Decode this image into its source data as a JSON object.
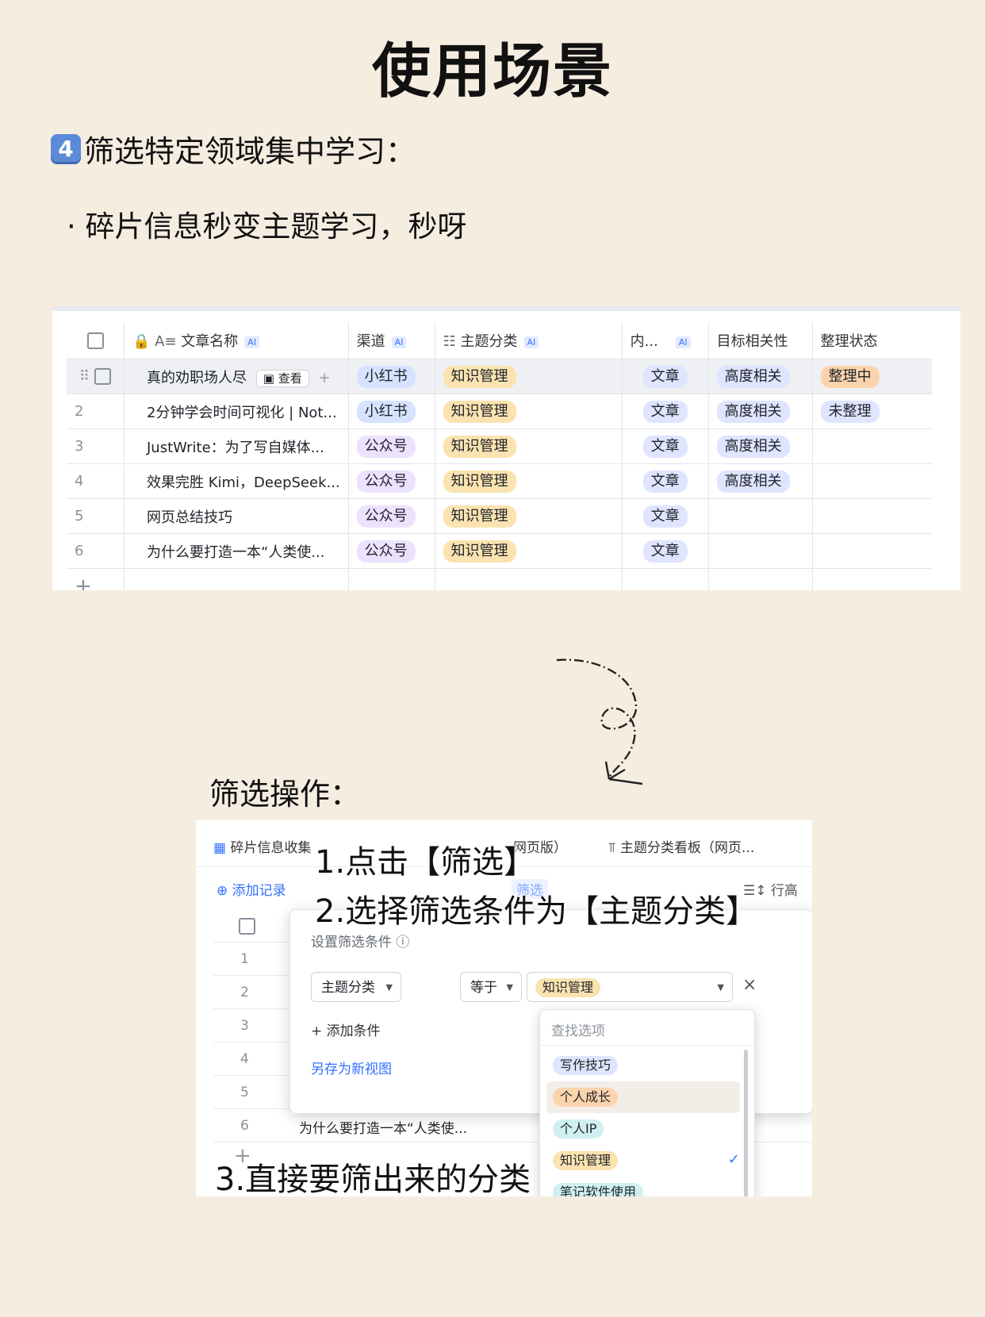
{
  "title": "使用场景",
  "section": {
    "keycap": "4",
    "heading": "筛选特定领域集中学习："
  },
  "bullet": "· 碎片信息秒变主题学习，秒呀",
  "table1": {
    "columns": [
      {
        "label": "文章名称",
        "ai": "AI"
      },
      {
        "label": "渠道",
        "ai": "AI"
      },
      {
        "label": "主题分类",
        "ai": "AI"
      },
      {
        "label": "内...",
        "ai": "AI"
      },
      {
        "label": "目标相关性",
        "ai": ""
      },
      {
        "label": "整理状态",
        "ai": ""
      }
    ],
    "view_label": "查看",
    "rows": [
      {
        "num": "",
        "name": "真的劝职场人尽",
        "channel": "小红书",
        "topic": "知识管理",
        "type": "文章",
        "relevance": "高度相关",
        "status": "整理中"
      },
      {
        "num": "2",
        "name": "2分钟学会时间可视化 | Not...",
        "channel": "小红书",
        "topic": "知识管理",
        "type": "文章",
        "relevance": "高度相关",
        "status": "未整理"
      },
      {
        "num": "3",
        "name": "JustWrite：为了写自媒体...",
        "channel": "公众号",
        "topic": "知识管理",
        "type": "文章",
        "relevance": "高度相关",
        "status": ""
      },
      {
        "num": "4",
        "name": "效果完胜 Kimi，DeepSeek...",
        "channel": "公众号",
        "topic": "知识管理",
        "type": "文章",
        "relevance": "高度相关",
        "status": ""
      },
      {
        "num": "5",
        "name": "网页总结技巧",
        "channel": "公众号",
        "topic": "知识管理",
        "type": "文章",
        "relevance": "",
        "status": ""
      },
      {
        "num": "6",
        "name": "为什么要打造一本“人类使...",
        "channel": "公众号",
        "topic": "知识管理",
        "type": "文章",
        "relevance": "",
        "status": ""
      }
    ],
    "add_row": "+"
  },
  "filter_title": "筛选操作：",
  "screen2": {
    "tab1": "碎片信息收集",
    "tab1_suffix": "网页版）",
    "tab2": "主题分类看板（网页...",
    "add_record": "添加记录",
    "filter_btn": "筛选",
    "row_height": "行高",
    "rows": [
      "1",
      "2",
      "3",
      "4",
      "5",
      "6"
    ],
    "row6_text": "为什么要打造一本“人类使...",
    "panel": {
      "heading": "设置筛选条件",
      "field": "主题分类",
      "operator": "等于",
      "value": "知识管理",
      "add_condition": "+ 添加条件",
      "save_view": "另存为新视图"
    },
    "dropdown": {
      "placeholder": "查找选项",
      "options": [
        "写作技巧",
        "个人成长",
        "个人IP",
        "知识管理",
        "笔记软件使用"
      ]
    },
    "add_row": "+"
  },
  "steps": {
    "step1": "1.点击【筛选】",
    "step2": "2.选择筛选条件为【主题分类】",
    "step3": "3.直接要筛出来的分类"
  },
  "colors": {
    "background": "#f6ede1",
    "accent": "#3370ff"
  }
}
